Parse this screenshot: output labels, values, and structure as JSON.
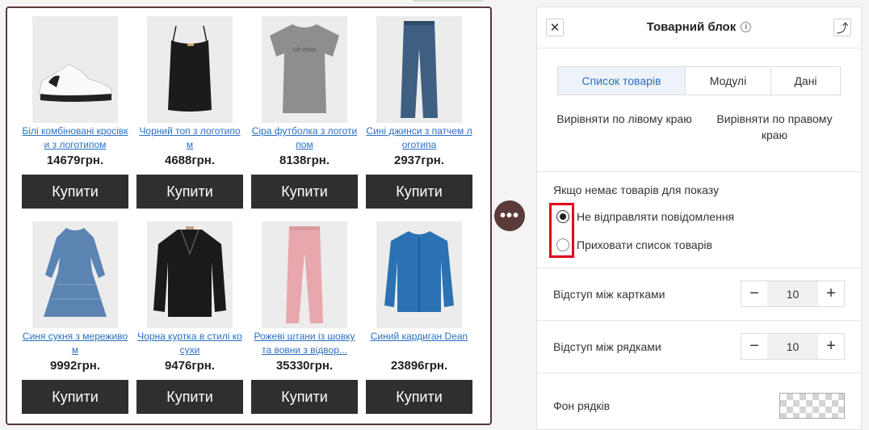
{
  "products": [
    {
      "name": "Білі комбіновані кросівки з логотипом",
      "price": "14679грн.",
      "buy": "Купити",
      "icon": "sneaker-image"
    },
    {
      "name": "Чорний топ з логотипом",
      "price": "4688грн.",
      "buy": "Купити",
      "icon": "top-image"
    },
    {
      "name": "Сіра футболка з логотипом",
      "price": "8138грн.",
      "buy": "Купити",
      "icon": "tshirt-image"
    },
    {
      "name": "Сині джинси з патчем логотипа",
      "price": "2937грн.",
      "buy": "Купити",
      "icon": "jeans-image"
    },
    {
      "name": "Синя сукня з мереживом",
      "price": "9992грн.",
      "buy": "Купити",
      "icon": "dress-image"
    },
    {
      "name": "Чорна куртка в стилі косухи",
      "price": "9476грн.",
      "buy": "Купити",
      "icon": "jacket-image"
    },
    {
      "name": "Рожеві штани із шовку та вовни з відвор...",
      "price": "35330грн.",
      "buy": "Купити",
      "icon": "pants-image"
    },
    {
      "name": "Синий кардиган Dean",
      "price": "23896грн.",
      "buy": "Купити",
      "icon": "cardigan-image"
    }
  ],
  "handle": {
    "label": "•••"
  },
  "panel": {
    "close_icon": "✕",
    "title": "Товарний блок",
    "info_icon": "i",
    "export_icon": "⤴",
    "tabs": [
      {
        "label": "Список товарів",
        "active": true
      },
      {
        "label": "Модулі",
        "active": false
      },
      {
        "label": "Дані",
        "active": false
      }
    ],
    "align_left": "Вирівняти по лівому краю",
    "align_right": "Вирівняти по правому краю",
    "empty_section": {
      "label": "Якщо немає товарів для показу",
      "options": [
        {
          "label": "Не відправляти повідомлення",
          "checked": true
        },
        {
          "label": "Приховати список товарів",
          "checked": false
        }
      ]
    },
    "card_gap": {
      "label": "Відступ між картками",
      "value": "10",
      "minus": "−",
      "plus": "+"
    },
    "row_gap": {
      "label": "Відступ між рядками",
      "value": "10",
      "minus": "−",
      "plus": "+"
    },
    "row_bg": {
      "label": "Фон рядків"
    }
  },
  "colors": {
    "accent": "#2a6fc1",
    "buy_button": "#2f2f2f",
    "highlight": "#e0001b",
    "handle": "#5b3a3a"
  }
}
